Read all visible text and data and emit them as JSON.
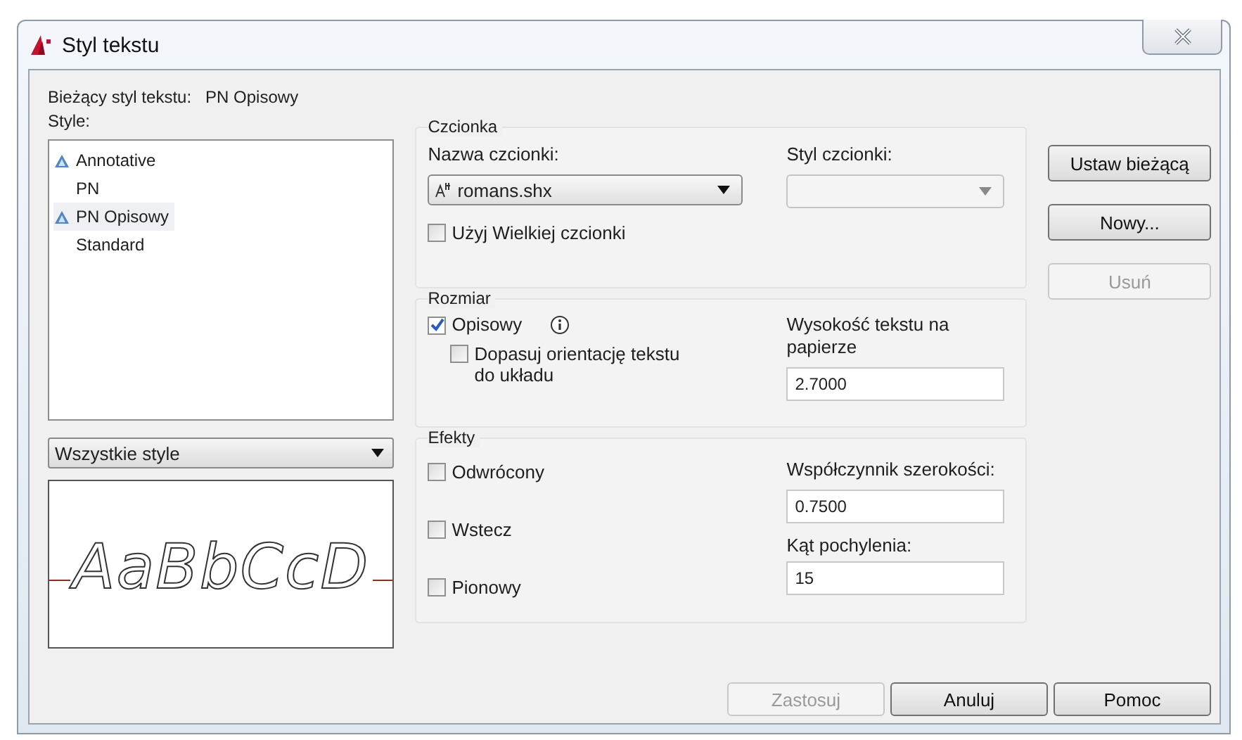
{
  "window": {
    "title": "Styl tekstu"
  },
  "current_style": {
    "label": "Bieżący styl tekstu:",
    "value": "PN Opisowy"
  },
  "styles": {
    "label": "Style:",
    "items": [
      {
        "name": "Annotative",
        "annotative": true,
        "selected": false
      },
      {
        "name": "PN",
        "annotative": false,
        "selected": false
      },
      {
        "name": "PN Opisowy",
        "annotative": true,
        "selected": true
      },
      {
        "name": "Standard",
        "annotative": false,
        "selected": false
      }
    ]
  },
  "filter": {
    "value": "Wszystkie style"
  },
  "preview": {
    "text": "AaBbCcD"
  },
  "font": {
    "title": "Czcionka",
    "name_label": "Nazwa czcionki:",
    "name_value": "romans.shx",
    "style_label": "Styl czcionki:",
    "style_disabled": true,
    "big_font": {
      "label": "Użyj Wielkiej czcionki",
      "checked": false
    }
  },
  "size": {
    "title": "Rozmiar",
    "annotative": {
      "label": "Opisowy",
      "checked": true
    },
    "match": {
      "label": "Dopasuj orientację tekstu do układu",
      "checked": false
    },
    "height_label": "Wysokość tekstu na papierze",
    "height_value": "2.7000"
  },
  "effects": {
    "title": "Efekty",
    "checks": [
      {
        "label": "Odwrócony",
        "checked": false
      },
      {
        "label": "Wstecz",
        "checked": false
      },
      {
        "label": "Pionowy",
        "checked": false
      }
    ],
    "width_label": "Współczynnik szerokości:",
    "width_value": "0.7500",
    "angle_label": "Kąt pochylenia:",
    "angle_value": "15"
  },
  "side_buttons": [
    {
      "label": "Ustaw bieżącą",
      "disabled": false
    },
    {
      "label": "Nowy...",
      "disabled": false
    },
    {
      "label": "Usuń",
      "disabled": true
    }
  ],
  "footer_buttons": [
    {
      "label": "Zastosuj",
      "disabled": true
    },
    {
      "label": "Anuluj",
      "disabled": false
    },
    {
      "label": "Pomoc",
      "disabled": false
    }
  ]
}
